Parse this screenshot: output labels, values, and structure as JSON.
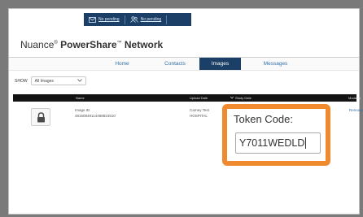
{
  "topbar": {
    "messages_link": "No pending",
    "contacts_link": "No pending"
  },
  "brand": {
    "company": "Nuance",
    "product_main": "PowerShare",
    "product_tail": "Network",
    "trademark": "®",
    "tm": "™"
  },
  "nav": {
    "tabs": [
      {
        "label": "Home"
      },
      {
        "label": "Contacts"
      },
      {
        "label": "Images"
      },
      {
        "label": "Messages"
      }
    ],
    "active_index": 2
  },
  "filter": {
    "show_label": "SHOW",
    "selected": "All Images"
  },
  "table": {
    "headers": [
      "Name",
      "Upload Date",
      "Study Date",
      "Modality"
    ],
    "row": {
      "id_label": "Image ID",
      "id_value": "48150849114468824510",
      "location_line1": "Carney Test",
      "location_line2": "HOSPITAL",
      "remove_label": "Remove"
    }
  },
  "token": {
    "label": "Token Code:",
    "value": "Y7011WEDLD"
  },
  "colors": {
    "navy": "#1b3f66",
    "orange_highlight": "#ef8a2e",
    "link_blue": "#2f6fa7"
  }
}
